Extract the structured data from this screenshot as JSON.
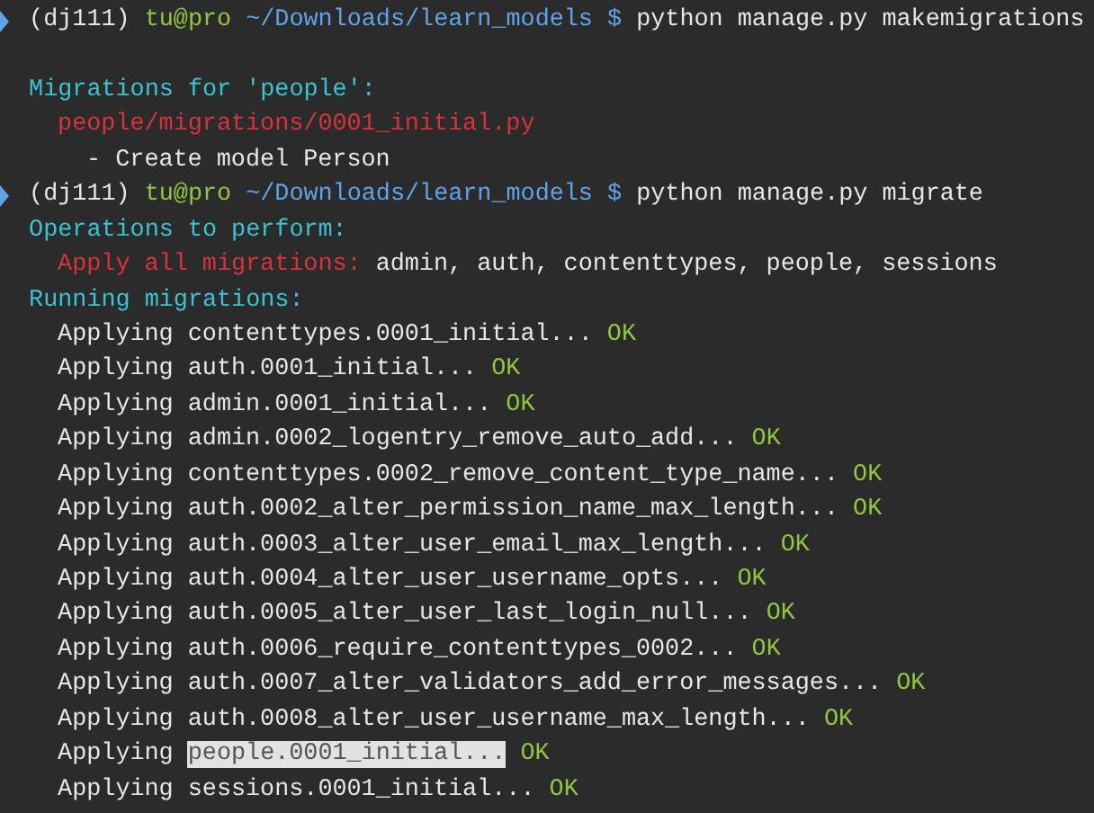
{
  "terminal": {
    "lines": [
      {
        "kind": "prompt",
        "segments": [
          {
            "text": "(dj111)",
            "kind": "env"
          },
          {
            "text": "tu@pro",
            "kind": "user"
          },
          {
            "text": "~/Downloads/learn_models",
            "kind": "path"
          },
          {
            "text": "$",
            "kind": "path"
          },
          {
            "text": "python manage.py makemigrations",
            "kind": "command"
          }
        ]
      },
      {
        "kind": "blank"
      },
      {
        "kind": "heading",
        "segments": [
          {
            "text": "Migrations for 'people':",
            "kind": "heading"
          }
        ]
      },
      {
        "kind": "item",
        "segments": [
          {
            "text": "people/migrations/0001_initial.py",
            "kind": "red"
          }
        ]
      },
      {
        "kind": "subitem",
        "segments": [
          {
            "text": "- Create model Person",
            "kind": "plain"
          }
        ]
      },
      {
        "kind": "prompt",
        "segments": [
          {
            "text": "(dj111)",
            "kind": "env"
          },
          {
            "text": "tu@pro",
            "kind": "user"
          },
          {
            "text": "~/Downloads/learn_models",
            "kind": "path"
          },
          {
            "text": "$",
            "kind": "path"
          },
          {
            "text": "python manage.py migrate",
            "kind": "command"
          }
        ]
      },
      {
        "kind": "heading",
        "segments": [
          {
            "text": "Operations to perform:",
            "kind": "heading"
          }
        ]
      },
      {
        "kind": "item",
        "segments": [
          {
            "text": "Apply all migrations:",
            "kind": "red"
          },
          {
            "text": "admin, auth, contenttypes, people, sessions",
            "kind": "plain"
          }
        ]
      },
      {
        "kind": "heading",
        "segments": [
          {
            "text": "Running migrations:",
            "kind": "heading"
          }
        ]
      },
      {
        "kind": "item",
        "segments": [
          {
            "text": "Applying contenttypes.0001_initial...",
            "kind": "plain"
          },
          {
            "text": "OK",
            "kind": "ok"
          }
        ]
      },
      {
        "kind": "item",
        "segments": [
          {
            "text": "Applying auth.0001_initial...",
            "kind": "plain"
          },
          {
            "text": "OK",
            "kind": "ok"
          }
        ]
      },
      {
        "kind": "item",
        "segments": [
          {
            "text": "Applying admin.0001_initial...",
            "kind": "plain"
          },
          {
            "text": "OK",
            "kind": "ok"
          }
        ]
      },
      {
        "kind": "item",
        "segments": [
          {
            "text": "Applying admin.0002_logentry_remove_auto_add...",
            "kind": "plain"
          },
          {
            "text": "OK",
            "kind": "ok"
          }
        ]
      },
      {
        "kind": "item",
        "segments": [
          {
            "text": "Applying contenttypes.0002_remove_content_type_name...",
            "kind": "plain"
          },
          {
            "text": "OK",
            "kind": "ok"
          }
        ]
      },
      {
        "kind": "item",
        "segments": [
          {
            "text": "Applying auth.0002_alter_permission_name_max_length...",
            "kind": "plain"
          },
          {
            "text": "OK",
            "kind": "ok"
          }
        ]
      },
      {
        "kind": "item",
        "segments": [
          {
            "text": "Applying auth.0003_alter_user_email_max_length...",
            "kind": "plain"
          },
          {
            "text": "OK",
            "kind": "ok"
          }
        ]
      },
      {
        "kind": "item",
        "segments": [
          {
            "text": "Applying auth.0004_alter_user_username_opts...",
            "kind": "plain"
          },
          {
            "text": "OK",
            "kind": "ok"
          }
        ]
      },
      {
        "kind": "item",
        "segments": [
          {
            "text": "Applying auth.0005_alter_user_last_login_null...",
            "kind": "plain"
          },
          {
            "text": "OK",
            "kind": "ok"
          }
        ]
      },
      {
        "kind": "item",
        "segments": [
          {
            "text": "Applying auth.0006_require_contenttypes_0002...",
            "kind": "plain"
          },
          {
            "text": "OK",
            "kind": "ok"
          }
        ]
      },
      {
        "kind": "item",
        "segments": [
          {
            "text": "Applying auth.0007_alter_validators_add_error_messages...",
            "kind": "plain"
          },
          {
            "text": "OK",
            "kind": "ok"
          }
        ]
      },
      {
        "kind": "item",
        "segments": [
          {
            "text": "Applying auth.0008_alter_user_username_max_length...",
            "kind": "plain"
          },
          {
            "text": "OK",
            "kind": "ok"
          }
        ]
      },
      {
        "kind": "item",
        "segments": [
          {
            "text": "Applying",
            "kind": "plain"
          },
          {
            "text": "people.0001_initial...",
            "kind": "selected"
          },
          {
            "text": "OK",
            "kind": "ok"
          }
        ]
      },
      {
        "kind": "item",
        "segments": [
          {
            "text": "Applying sessions.0001_initial...",
            "kind": "plain"
          },
          {
            "text": "OK",
            "kind": "ok"
          }
        ]
      }
    ]
  }
}
